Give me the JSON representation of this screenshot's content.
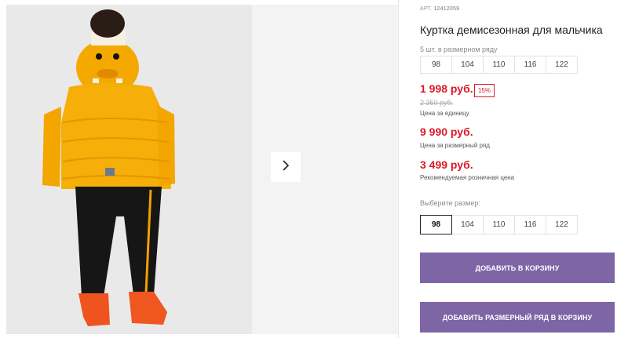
{
  "product": {
    "article_label": "АРТ.",
    "article_number": "12412059",
    "title": "Куртка демисезонная для мальчика"
  },
  "series": {
    "label": "5 шт. в размерном ряду",
    "sizes": [
      "98",
      "104",
      "110",
      "116",
      "122"
    ]
  },
  "prices": {
    "unit_price": "1 998 руб.",
    "discount": "15%",
    "old_price": "2 350 руб.",
    "unit_note": "Цена за единицу",
    "series_price": "9 990 руб.",
    "series_note": "Цена за размерный ряд",
    "retail_price": "3 499 руб.",
    "retail_note": "Рекомендуемая розничная цена",
    "accent_color": "#d91a2a"
  },
  "size_picker": {
    "label": "Выберите размер:",
    "sizes": [
      "98",
      "104",
      "110",
      "116",
      "122"
    ],
    "selected": "98"
  },
  "buttons": {
    "add_to_cart": "ДОБАВИТЬ В КОРЗИНУ",
    "add_series_to_cart": "ДОБАВИТЬ РАЗМЕРНЫЙ РЯД В КОРЗИНУ",
    "color": "#7d65a6"
  },
  "gallery": {
    "next_icon": "chevron-right-icon"
  }
}
